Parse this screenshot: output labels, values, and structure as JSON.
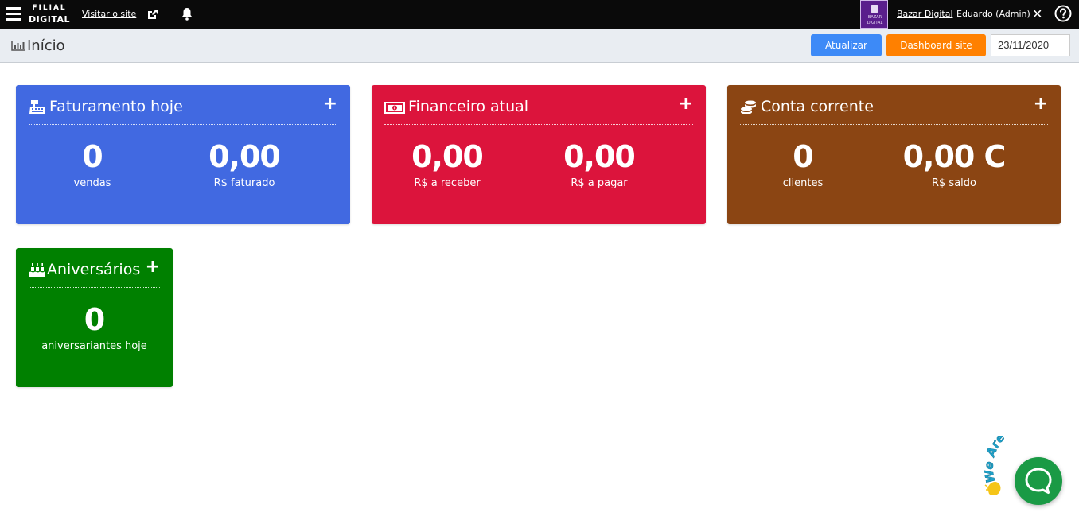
{
  "topbar": {
    "brand_line1": "FILIAL",
    "brand_line2": "DIGITAL",
    "visit_site": "Visitar o site",
    "shop_logo_line1": "BAZAR",
    "shop_logo_line2": "DIGITAL",
    "shop_name": "Bazar Digital",
    "user": "Eduardo (Admin)"
  },
  "header": {
    "title": "Início",
    "refresh_label": "Atualizar",
    "dashboard_label": "Dashboard site",
    "date": "23/11/2020"
  },
  "cards": {
    "billing": {
      "title": "Faturamento hoje",
      "plus": "+",
      "stat1_value": "0",
      "stat1_label": "vendas",
      "stat2_value": "0,00",
      "stat2_label": "R$ faturado",
      "color": "#4169e1"
    },
    "finance": {
      "title": "Financeiro atual",
      "plus": "+",
      "stat1_value": "0,00",
      "stat1_label": "R$ a receber",
      "stat2_value": "0,00",
      "stat2_label": "R$ a pagar",
      "color": "#dc143c"
    },
    "account": {
      "title": "Conta corrente",
      "plus": "+",
      "stat1_value": "0",
      "stat1_label": "clientes",
      "stat2_value": "0,00 C",
      "stat2_label": "R$ saldo",
      "color": "#8b4513"
    },
    "birthdays": {
      "title": "Aniversários",
      "plus": "+",
      "stat1_value": "0",
      "stat1_label": "aniversariantes hoje",
      "color": "#008000"
    }
  },
  "chat": {
    "badge_text": "We Are Here!",
    "color": "#1a9a45"
  },
  "icons": {
    "menu": "hamburger-icon",
    "external": "external-link-icon",
    "notifications": "bell-icon",
    "close": "close-icon",
    "help": "help-icon",
    "page": "bar-chart-icon",
    "billing": "cash-register-icon",
    "finance": "money-bill-icon",
    "account": "coins-icon",
    "birthdays": "birthday-cake-icon",
    "chat": "chat-bubble-icon",
    "wave": "waving-hand-icon"
  }
}
